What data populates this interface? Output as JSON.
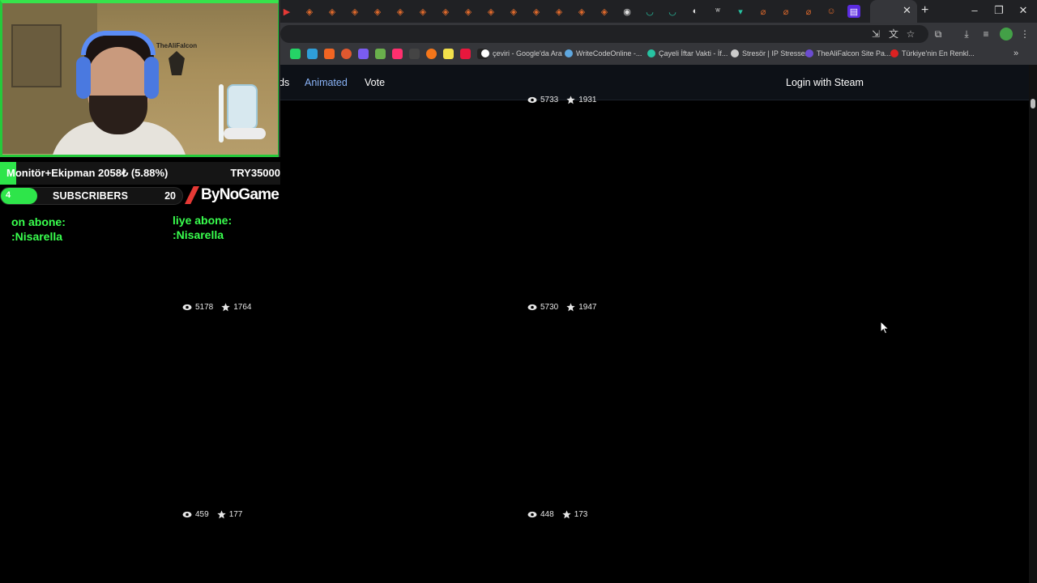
{
  "browser": {
    "bookmarks": [
      {
        "label": "çeviri - Google'da Ara"
      },
      {
        "label": "WriteCodeOnline -..."
      },
      {
        "label": "Çayeli İftar Vakti - İf..."
      },
      {
        "label": "Stresör | IP Stresser"
      },
      {
        "label": "TheAliFalcon Site Pa..."
      },
      {
        "label": "Türkiye'nin En Renkl..."
      }
    ],
    "tab_close": "✕",
    "new_tab": "+"
  },
  "site_nav": {
    "partial_link": "ds",
    "animated": "Animated",
    "vote": "Vote",
    "login": "Login with Steam"
  },
  "cards": [
    {
      "views": "5733",
      "stars": "1931"
    },
    {
      "views": "5178",
      "stars": "1764"
    },
    {
      "views": "5730",
      "stars": "1947"
    },
    {
      "views": "459",
      "stars": "177"
    },
    {
      "views": "448",
      "stars": "173"
    }
  ],
  "overlay": {
    "channel_logo": "TheAliFalcon",
    "goal": {
      "text": "Monitör+Ekipman 2058₺ (5.88%)",
      "target": "TRY35000",
      "fraction": 0.0588
    },
    "subscribers": {
      "count": "4",
      "label": "SUBSCRIBERS",
      "goal": "20",
      "fraction": 0.2
    },
    "sponsor": "ByNoGame",
    "alert_left": {
      "line1": "on abone:",
      "line2": ":Nisarella"
    },
    "alert_right": {
      "line1": "liye abone:",
      "line2": ":Nisarella"
    }
  },
  "colors": {
    "accent_green": "#2ee54a",
    "nav_active": "#8ab4f8",
    "site_bg": "#0d1117",
    "sponsor_red": "#e53935"
  }
}
